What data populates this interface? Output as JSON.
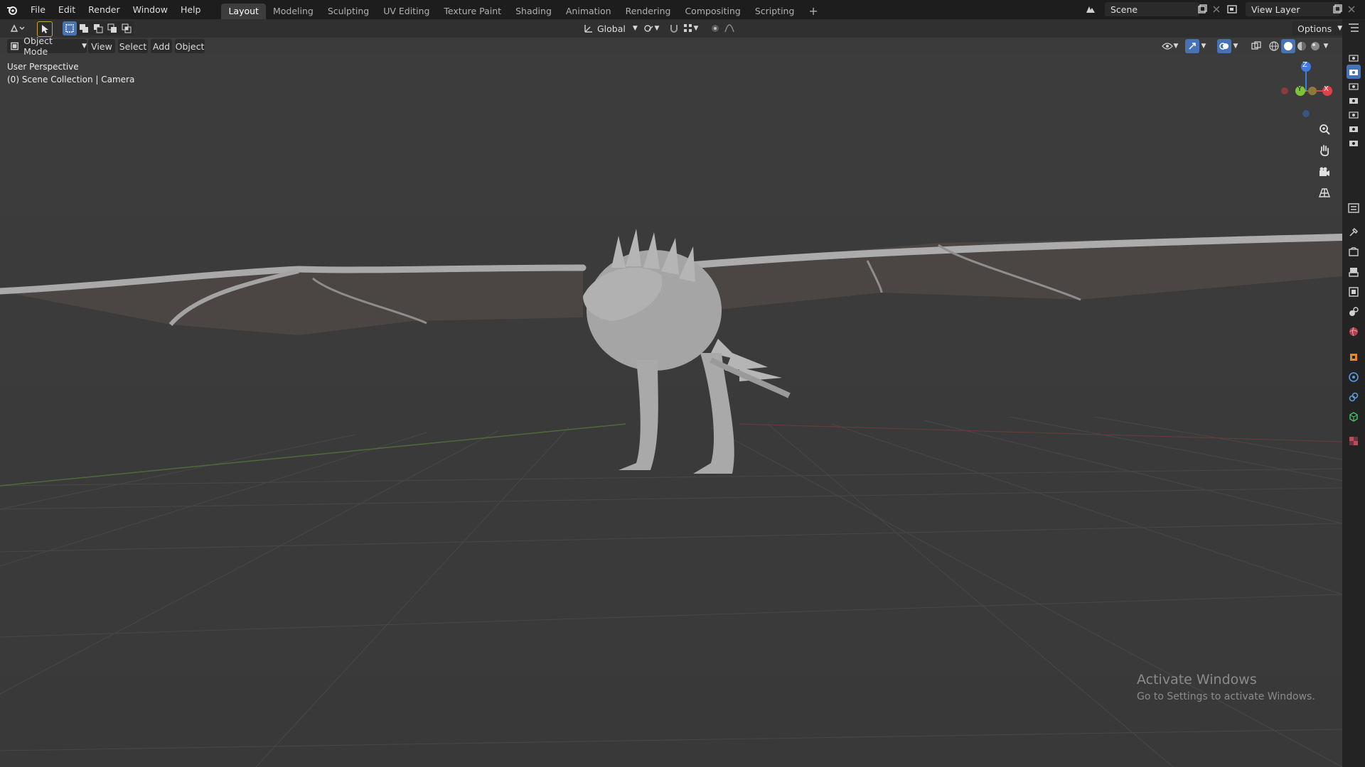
{
  "topbar": {
    "menus": [
      "File",
      "Edit",
      "Render",
      "Window",
      "Help"
    ],
    "workspaces": [
      "Layout",
      "Modeling",
      "Sculpting",
      "UV Editing",
      "Texture Paint",
      "Shading",
      "Animation",
      "Rendering",
      "Compositing",
      "Scripting"
    ],
    "active_workspace": "Layout",
    "add_tab": "+",
    "scene_name": "Scene",
    "view_layer_name": "View Layer"
  },
  "header": {
    "orientation": "Global",
    "options_label": "Options"
  },
  "viewport_header": {
    "mode": "Object Mode",
    "menus": [
      "View",
      "Select",
      "Add",
      "Object"
    ]
  },
  "viewport": {
    "view_name": "User Perspective",
    "collection_info": "(0) Scene Collection | Camera",
    "gizmo_labels": {
      "z": "Z",
      "x": "X",
      "y": "Y"
    }
  },
  "watermark": {
    "title": "Activate Windows",
    "subtitle": "Go to Settings to activate Windows."
  },
  "colors": {
    "axis_x": "#e0404a",
    "axis_y": "#7ec43a",
    "axis_z": "#3f7ddc",
    "active_tab": "#3d3d3d",
    "viewport_bg": "#3b3b3b"
  }
}
